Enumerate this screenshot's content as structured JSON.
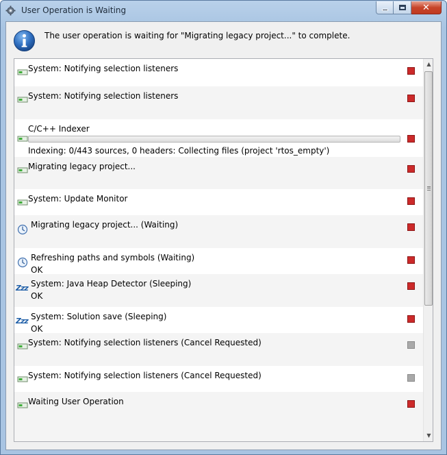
{
  "window": {
    "title": "User Operation is Waiting"
  },
  "message": "The user operation is waiting for \"Migrating legacy project...\" to complete.",
  "jobs": [
    {
      "title": "System: Notifying selection listeners",
      "icon": "job-icon",
      "stop": "active"
    },
    {
      "title": "System: Notifying selection listeners",
      "icon": "job-icon",
      "stop": "active"
    },
    {
      "title": "C/C++ Indexer",
      "icon": "job-icon",
      "progress": 0,
      "subtitle": "Indexing: 0/443 sources, 0 headers: Collecting files (project 'rtos_empty')",
      "stop": "active"
    },
    {
      "title": "Migrating legacy project...",
      "icon": "job-icon",
      "stop": "active"
    },
    {
      "title": "System: Update Monitor",
      "icon": "job-icon",
      "stop": "active"
    },
    {
      "title": "Migrating legacy project... (Waiting)",
      "icon": "clock-icon",
      "stop": "active"
    },
    {
      "title": "Refreshing paths and symbols (Waiting)",
      "icon": "clock-icon",
      "subtitle": "OK",
      "stop": "active"
    },
    {
      "title": "System: Java Heap Detector (Sleeping)",
      "icon": "sleep-icon",
      "subtitle": "OK",
      "stop": "active"
    },
    {
      "title": "System: Solution save (Sleeping)",
      "icon": "sleep-icon",
      "subtitle": "OK",
      "stop": "active"
    },
    {
      "title": "System: Notifying selection listeners (Cancel Requested)",
      "icon": "job-icon",
      "stop": "disabled"
    },
    {
      "title": "System: Notifying selection listeners (Cancel Requested)",
      "icon": "job-icon",
      "stop": "disabled"
    },
    {
      "title": "Waiting User Operation",
      "icon": "job-icon",
      "stop": "active"
    }
  ],
  "icons": {
    "sleep_glyph": "Zzz"
  },
  "colors": {
    "stop_active": "#cc2a2a",
    "stop_disabled": "#a9a9a9",
    "info_blue": "#1f5fa8"
  }
}
